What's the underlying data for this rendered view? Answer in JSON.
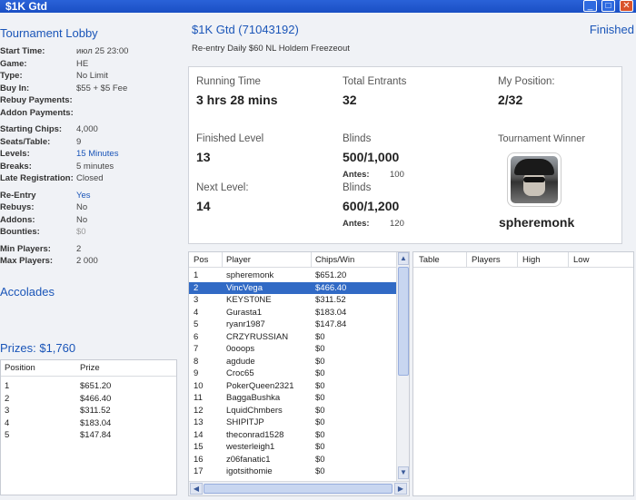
{
  "window": {
    "title": "$1K Gtd"
  },
  "left": {
    "lobby_title": "Tournament Lobby",
    "info": [
      {
        "label": "Start Time:",
        "value": "июл 25 23:00",
        "style": ""
      },
      {
        "label": "Game:",
        "value": "HE",
        "style": ""
      },
      {
        "label": "Type:",
        "value": "No Limit",
        "style": ""
      },
      {
        "label": "Buy In:",
        "value": "$55 + $5 Fee",
        "style": ""
      },
      {
        "label": "Rebuy Payments:",
        "value": "",
        "style": ""
      },
      {
        "label": "Addon Payments:",
        "value": "",
        "style": ""
      },
      {
        "label": "Starting Chips:",
        "value": "4,000",
        "style": ""
      },
      {
        "label": "Seats/Table:",
        "value": "9",
        "style": ""
      },
      {
        "label": "Levels:",
        "value": "15 Minutes",
        "style": "link"
      },
      {
        "label": "Breaks:",
        "value": "5 minutes",
        "style": ""
      },
      {
        "label": "Late Registration:",
        "value": "Closed",
        "style": ""
      },
      {
        "label": "Re-Entry",
        "value": "Yes",
        "style": "link"
      },
      {
        "label": "Rebuys:",
        "value": "No",
        "style": ""
      },
      {
        "label": "Addons:",
        "value": "No",
        "style": ""
      },
      {
        "label": "Bounties:",
        "value": "$0",
        "style": "muted"
      },
      {
        "label": "Min Players:",
        "value": "2",
        "style": ""
      },
      {
        "label": "Max Players:",
        "value": "2 000",
        "style": ""
      }
    ],
    "accolades_title": "Accolades",
    "prizes_title": "Prizes: $1,760",
    "prize_headers": {
      "position": "Position",
      "prize": "Prize"
    },
    "prizes": [
      {
        "position": "1",
        "prize": "$651.20"
      },
      {
        "position": "2",
        "prize": "$466.40"
      },
      {
        "position": "3",
        "prize": "$311.52"
      },
      {
        "position": "4",
        "prize": "$183.04"
      },
      {
        "position": "5",
        "prize": "$147.84"
      }
    ]
  },
  "header": {
    "title": "$1K Gtd (71043192)",
    "status": "Finished",
    "subtitle": "Re-entry Daily $60 NL Holdem Freezeout"
  },
  "stats": {
    "running_time_label": "Running Time",
    "running_time": "3 hrs 28 mins",
    "total_entrants_label": "Total Entrants",
    "total_entrants": "32",
    "my_position_label": "My Position:",
    "my_position": "2/32",
    "finished_level_label": "Finished Level",
    "finished_level": "13",
    "blinds_label": "Blinds",
    "blinds": "500/1,000",
    "antes_label": "Antes:",
    "antes": "100",
    "next_level_label": "Next Level:",
    "next_level": "14",
    "next_blinds_label": "Blinds",
    "next_blinds": "600/1,200",
    "next_antes_label": "Antes:",
    "next_antes": "120",
    "winner_label": "Tournament Winner",
    "winner_name": "spheremonk"
  },
  "players": {
    "headers": {
      "pos": "Pos",
      "player": "Player",
      "chips": "Chips/Win"
    },
    "rows": [
      {
        "pos": "1",
        "player": "spheremonk",
        "chips": "$651.20"
      },
      {
        "pos": "2",
        "player": "VincVega",
        "chips": "$466.40"
      },
      {
        "pos": "3",
        "player": "KEYST0NE",
        "chips": "$311.52"
      },
      {
        "pos": "4",
        "player": "Gurasta1",
        "chips": "$183.04"
      },
      {
        "pos": "5",
        "player": "ryanr1987",
        "chips": "$147.84"
      },
      {
        "pos": "6",
        "player": "CRZYRUSSIAN",
        "chips": "$0"
      },
      {
        "pos": "7",
        "player": "0ooops",
        "chips": "$0"
      },
      {
        "pos": "8",
        "player": "agdude",
        "chips": "$0"
      },
      {
        "pos": "9",
        "player": "Croc65",
        "chips": "$0"
      },
      {
        "pos": "10",
        "player": "PokerQueen2321",
        "chips": "$0"
      },
      {
        "pos": "11",
        "player": "BaggaBushka",
        "chips": "$0"
      },
      {
        "pos": "12",
        "player": "LquidChmbers",
        "chips": "$0"
      },
      {
        "pos": "13",
        "player": "SHIPITJP",
        "chips": "$0"
      },
      {
        "pos": "14",
        "player": "theconrad1528",
        "chips": "$0"
      },
      {
        "pos": "15",
        "player": "westerleigh1",
        "chips": "$0"
      },
      {
        "pos": "16",
        "player": "z06fanatic1",
        "chips": "$0"
      },
      {
        "pos": "17",
        "player": "igotsithomie",
        "chips": "$0"
      }
    ],
    "selected_row": 1
  },
  "tables": {
    "headers": {
      "table": "Table",
      "players": "Players",
      "high": "High",
      "low": "Low"
    }
  }
}
